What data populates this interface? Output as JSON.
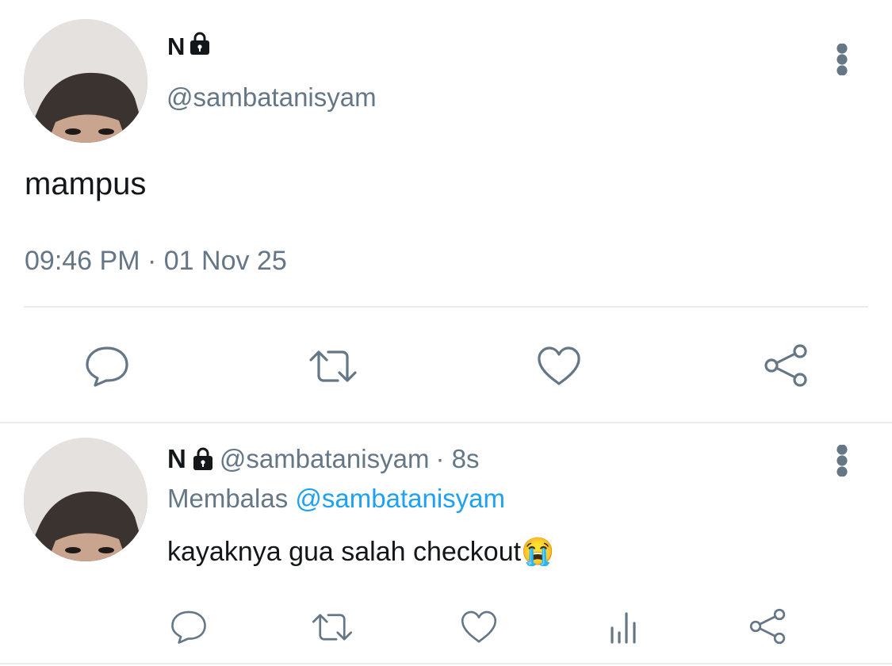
{
  "main_tweet": {
    "author_name": "N",
    "handle": "@sambatanisyam",
    "text": "mampus",
    "timestamp": "09:46 PM · 01 Nov 25",
    "actions": [
      "reply-icon",
      "retweet-icon",
      "like-icon",
      "share-icon"
    ]
  },
  "reply_tweet": {
    "author_name": "N",
    "handle": "@sambatanisyam",
    "time_ago": "· 8s",
    "replying_label": "Membalas",
    "replying_to": "@sambatanisyam",
    "text": "kayaknya gua salah checkout😭",
    "actions": [
      "reply-icon",
      "retweet-icon",
      "like-icon",
      "analytics-icon",
      "share-icon"
    ]
  },
  "colors": {
    "text": "#14171a",
    "muted": "#657786",
    "link": "#1da1f2",
    "divider": "#e6ecf0"
  }
}
